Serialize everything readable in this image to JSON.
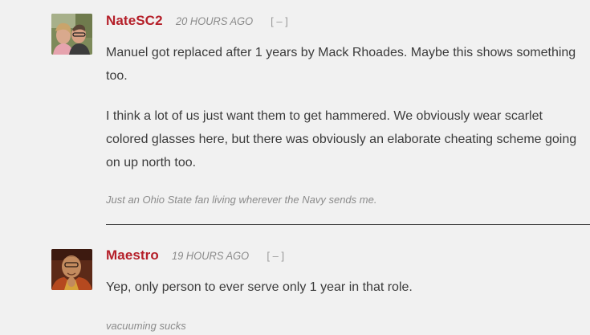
{
  "comments": [
    {
      "username": "NateSC2",
      "timestamp": "20 HOURS AGO",
      "collapse_label": "[ – ]",
      "paragraphs": [
        "Manuel got replaced after 1 years by Mack Rhoades. Maybe this shows something too.",
        "I think a lot of us just want them to get hammered.  We obviously wear scarlet colored glasses here, but there was obviously an elaborate cheating scheme going on up north too."
      ],
      "signature": "Just an Ohio State fan living wherever the Navy sends me."
    },
    {
      "username": "Maestro",
      "timestamp": "19 HOURS AGO",
      "collapse_label": "[ – ]",
      "paragraphs": [
        "Yep, only person to ever serve only 1 year in that role."
      ],
      "signature": "vacuuming sucks"
    }
  ]
}
